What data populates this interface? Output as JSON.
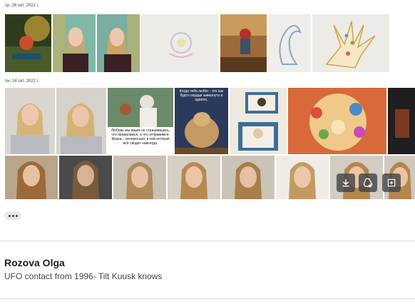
{
  "groups": [
    {
      "date": "ср, 26 окт. 2022 г."
    },
    {
      "date": "пн, 24 окт. 2022 г."
    }
  ],
  "meme": {
    "top_text": "Когда тебя любят - это как будто сердце завернуто в одеяло.",
    "bottom_text": "Любовь мы ищем не страшившись, что провалимся, а что отправимся. Жизнь - интересная, в ней которая всё сводит навсегда."
  },
  "overlay_actions": [
    {
      "name": "download-icon",
      "label": "Download"
    },
    {
      "name": "add-to-drive-icon",
      "label": "Add to Drive"
    },
    {
      "name": "add-to-photos-icon",
      "label": "Add to Photos"
    }
  ],
  "message": {
    "sender": "Rozova Olga",
    "subject": "UFO contact from 1996- Tilt Kuusk knows"
  },
  "colors": {
    "divider": "#dadce0",
    "overlay": "#3c4043"
  }
}
